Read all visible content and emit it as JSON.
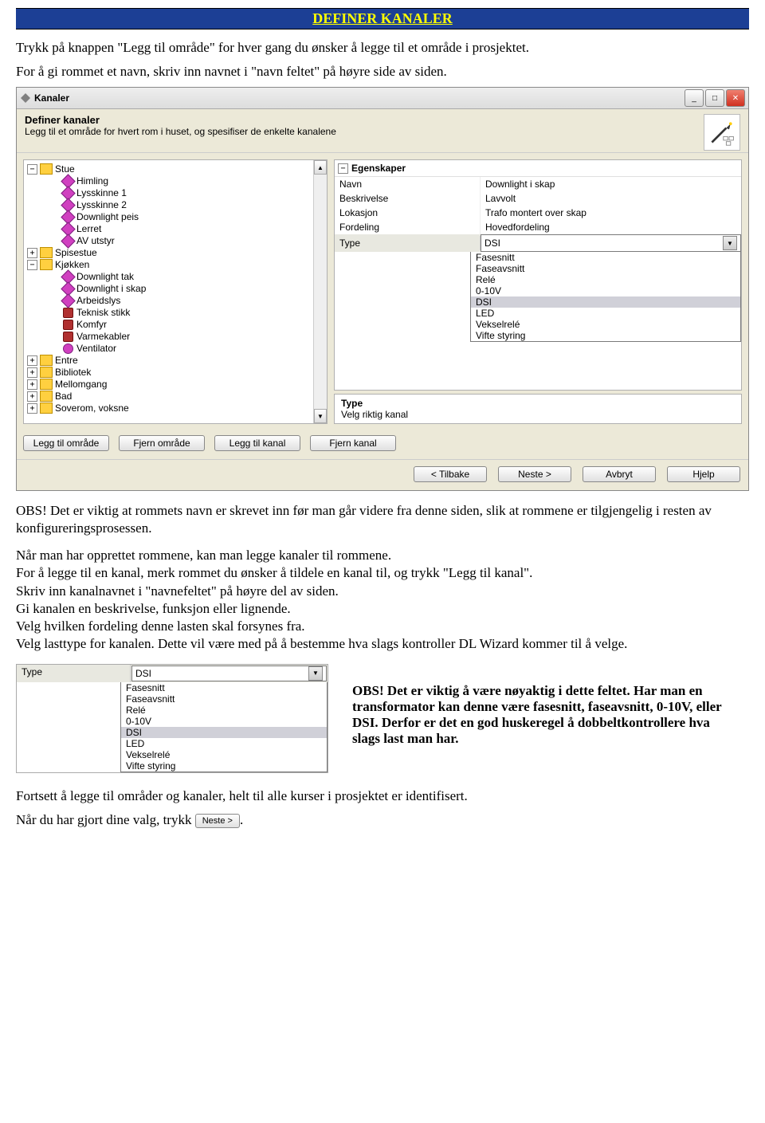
{
  "header": {
    "title": "DEFINER KANALER"
  },
  "intro": {
    "p1": "Trykk på knappen \"Legg til område\" for hver gang du ønsker å legge til et område i prosjektet.",
    "p2": "For å gi rommet et navn, skriv inn navnet i \"navn feltet\" på høyre side av siden."
  },
  "window": {
    "title": "Kanaler",
    "definer_heading": "Definer kanaler",
    "definer_sub": "Legg til et område for hvert rom i huset, og spesifiser de enkelte kanalene",
    "tree": {
      "rooms": [
        {
          "name": "Stue",
          "expanded": true,
          "children": [
            {
              "name": "Himling",
              "icon": "light"
            },
            {
              "name": "Lysskinne 1",
              "icon": "light"
            },
            {
              "name": "Lysskinne 2",
              "icon": "light"
            },
            {
              "name": "Downlight peis",
              "icon": "light"
            },
            {
              "name": "Lerret",
              "icon": "light"
            },
            {
              "name": "AV utstyr",
              "icon": "light"
            }
          ]
        },
        {
          "name": "Spisestue",
          "expanded": false
        },
        {
          "name": "Kjøkken",
          "expanded": true,
          "children": [
            {
              "name": "Downlight tak",
              "icon": "light"
            },
            {
              "name": "Downlight i skap",
              "icon": "light"
            },
            {
              "name": "Arbeidslys",
              "icon": "light"
            },
            {
              "name": "Teknisk stikk",
              "icon": "power"
            },
            {
              "name": "Komfyr",
              "icon": "power"
            },
            {
              "name": "Varmekabler",
              "icon": "power"
            },
            {
              "name": "Ventilator",
              "icon": "fan"
            }
          ]
        },
        {
          "name": "Entre",
          "expanded": false
        },
        {
          "name": "Bibliotek",
          "expanded": false
        },
        {
          "name": "Mellomgang",
          "expanded": false
        },
        {
          "name": "Bad",
          "expanded": false
        },
        {
          "name": "Soverom, voksne",
          "expanded": false
        }
      ]
    },
    "props": {
      "egenskaper_label": "Egenskaper",
      "rows": [
        {
          "label": "Navn",
          "value": "Downlight i skap"
        },
        {
          "label": "Beskrivelse",
          "value": "Lavvolt"
        },
        {
          "label": "Lokasjon",
          "value": "Trafo montert over skap"
        },
        {
          "label": "Fordeling",
          "value": "Hovedfordeling"
        }
      ],
      "type_label": "Type",
      "type_value": "DSI",
      "type_options": [
        "Fasesnitt",
        "Faseavsnitt",
        "Relé",
        "0-10V",
        "DSI",
        "LED",
        "Vekselrelé",
        "Vifte styring"
      ],
      "type_heading": "Type",
      "type_desc": "Velg riktig kanal"
    },
    "buttons": {
      "add_area": "Legg til område",
      "remove_area": "Fjern område",
      "add_channel": "Legg til kanal",
      "remove_channel": "Fjern kanal"
    },
    "nav": {
      "back": "< Tilbake",
      "next": "Neste >",
      "cancel": "Avbryt",
      "help": "Hjelp"
    }
  },
  "after1": {
    "p1": "OBS! Det er viktig at rommets navn er skrevet inn før man går videre fra denne siden, slik at rommene er tilgjengelig i resten av konfigureringsprosessen.",
    "p2": "Når man har opprettet rommene, kan man legge kanaler til rommene.",
    "p3": "For å legge til en kanal, merk rommet du ønsker å tildele en kanal til, og trykk \"Legg til kanal\".",
    "p4": "Skriv inn kanalnavnet i \"navnefeltet\" på høyre del av siden.",
    "p5": "Gi kanalen en beskrivelse, funksjon eller lignende.",
    "p6": "Velg hvilken fordeling denne lasten skal forsynes fra.",
    "p7": "Velg lasttype for kanalen. Dette vil være med på å bestemme hva slags kontroller DL Wizard kommer til å velge."
  },
  "type_panel": {
    "label": "Type",
    "value": "DSI",
    "options": [
      "Fasesnitt",
      "Faseavsnitt",
      "Relé",
      "0-10V",
      "DSI",
      "LED",
      "Vekselrelé",
      "Vifte styring"
    ]
  },
  "advice": {
    "text": "OBS! Det er viktig å være nøyaktig i dette feltet. Har man en transformator kan denne være fasesnitt, faseavsnitt, 0-10V, eller DSI. Derfor er det en god huskeregel å dobbeltkontrollere hva slags last man har."
  },
  "closing": {
    "p1": "Fortsett å legge til områder og kanaler, helt til alle kurser i prosjektet er identifisert.",
    "p2a": "Når du har gjort dine valg, trykk",
    "next_btn": "Neste >",
    "p2b": "."
  }
}
